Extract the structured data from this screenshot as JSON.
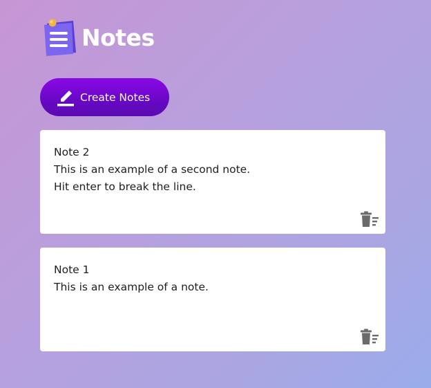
{
  "app": {
    "title": "Notes"
  },
  "toolbar": {
    "create_label": "Create Notes"
  },
  "notes": [
    {
      "lines": [
        "Note 2",
        "This is an example of a second note.",
        "Hit enter to break the line."
      ]
    },
    {
      "lines": [
        "Note 1",
        "This is an example of a note."
      ]
    }
  ],
  "icons": {
    "logo": "notepad-icon",
    "create": "pencil-icon",
    "delete": "trash-icon"
  },
  "colors": {
    "button_primary": "#7a08d8",
    "card_bg": "#ffffff",
    "icon_gray": "#6b6b6b"
  }
}
